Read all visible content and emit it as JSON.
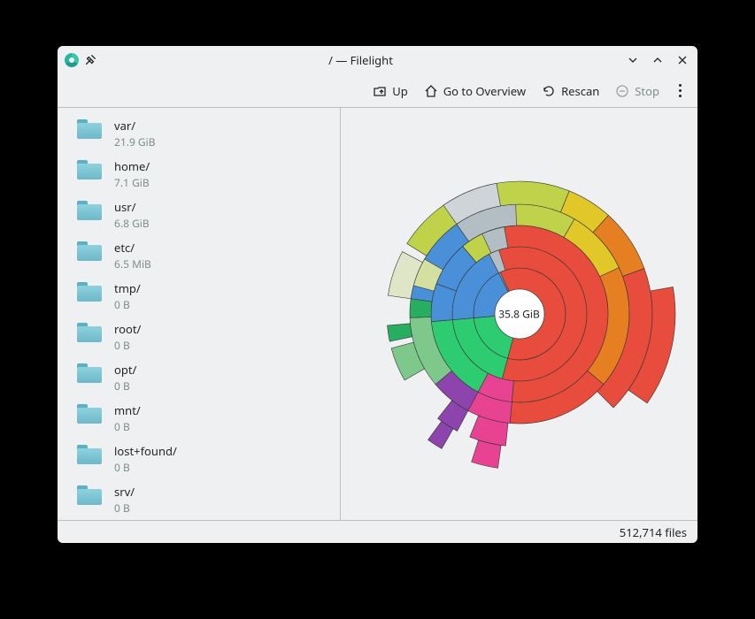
{
  "window": {
    "title": "/ — Filelight"
  },
  "toolbar": {
    "up": "Up",
    "overview": "Go to Overview",
    "rescan": "Rescan",
    "stop": "Stop"
  },
  "sidebar": {
    "items": [
      {
        "name": "var/",
        "size": "21.9 GiB"
      },
      {
        "name": "home/",
        "size": "7.1 GiB"
      },
      {
        "name": "usr/",
        "size": "6.8 GiB"
      },
      {
        "name": "etc/",
        "size": "6.5 MiB"
      },
      {
        "name": "tmp/",
        "size": "0 B"
      },
      {
        "name": "root/",
        "size": "0 B"
      },
      {
        "name": "opt/",
        "size": "0 B"
      },
      {
        "name": "mnt/",
        "size": "0 B"
      },
      {
        "name": "lost+found/",
        "size": "0 B"
      },
      {
        "name": "srv/",
        "size": "0 B"
      }
    ]
  },
  "chart_data": {
    "type": "sunburst",
    "center_label": "35.8 GiB",
    "total_label": "35.8 GiB",
    "unit": "GiB",
    "rings": 5,
    "root": {
      "name": "/",
      "value": 35.8,
      "children": [
        {
          "name": "var/",
          "value": 21.9,
          "color": "#e74c3c"
        },
        {
          "name": "home/",
          "value": 7.1,
          "color": "#2ecc71"
        },
        {
          "name": "usr/",
          "value": 6.8,
          "color": "#3498db"
        },
        {
          "name": "etc/",
          "value": 0.006,
          "color": "#9b59b6"
        },
        {
          "name": "tmp/",
          "value": 0,
          "color": "#95a5a6"
        },
        {
          "name": "root/",
          "value": 0,
          "color": "#95a5a6"
        },
        {
          "name": "opt/",
          "value": 0,
          "color": "#95a5a6"
        },
        {
          "name": "mnt/",
          "value": 0,
          "color": "#95a5a6"
        },
        {
          "name": "lost+found/",
          "value": 0,
          "color": "#95a5a6"
        },
        {
          "name": "srv/",
          "value": 0,
          "color": "#95a5a6"
        }
      ]
    },
    "ring_colors_outer": [
      "#c0d24a",
      "#e1c728",
      "#e67e22",
      "#d35400",
      "#e84393",
      "#8e44ad",
      "#b2bec3",
      "#4a90d9",
      "#27ae60",
      "#7fc88c"
    ]
  },
  "statusbar": {
    "files": "512,714 files"
  }
}
